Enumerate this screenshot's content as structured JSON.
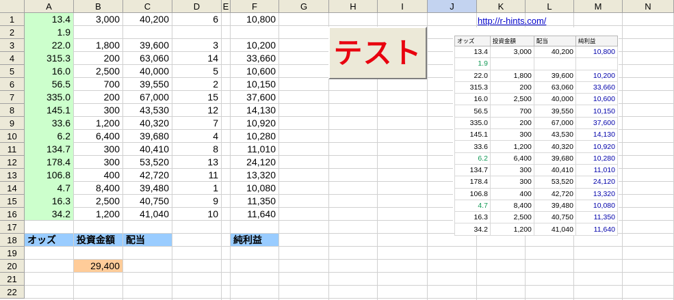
{
  "columns": [
    "A",
    "B",
    "C",
    "D",
    "E",
    "F",
    "G",
    "H",
    "I",
    "J",
    "K",
    "L",
    "M",
    "N"
  ],
  "selected_column": "J",
  "rows": [
    "1",
    "2",
    "3",
    "4",
    "5",
    "6",
    "7",
    "8",
    "9",
    "10",
    "11",
    "12",
    "13",
    "14",
    "15",
    "16",
    "17",
    "18",
    "19",
    "20",
    "21",
    "22"
  ],
  "data_rows": [
    {
      "odds": "13.4",
      "bet": "3,000",
      "payout": "40,200",
      "count": "6",
      "profit": "10,800"
    },
    {
      "odds": "1.9",
      "bet": "",
      "payout": "",
      "count": "",
      "profit": ""
    },
    {
      "odds": "22.0",
      "bet": "1,800",
      "payout": "39,600",
      "count": "3",
      "profit": "10,200"
    },
    {
      "odds": "315.3",
      "bet": "200",
      "payout": "63,060",
      "count": "14",
      "profit": "33,660"
    },
    {
      "odds": "16.0",
      "bet": "2,500",
      "payout": "40,000",
      "count": "5",
      "profit": "10,600"
    },
    {
      "odds": "56.5",
      "bet": "700",
      "payout": "39,550",
      "count": "2",
      "profit": "10,150"
    },
    {
      "odds": "335.0",
      "bet": "200",
      "payout": "67,000",
      "count": "15",
      "profit": "37,600"
    },
    {
      "odds": "145.1",
      "bet": "300",
      "payout": "43,530",
      "count": "12",
      "profit": "14,130"
    },
    {
      "odds": "33.6",
      "bet": "1,200",
      "payout": "40,320",
      "count": "7",
      "profit": "10,920"
    },
    {
      "odds": "6.2",
      "bet": "6,400",
      "payout": "39,680",
      "count": "4",
      "profit": "10,280"
    },
    {
      "odds": "134.7",
      "bet": "300",
      "payout": "40,410",
      "count": "8",
      "profit": "11,010"
    },
    {
      "odds": "178.4",
      "bet": "300",
      "payout": "53,520",
      "count": "13",
      "profit": "24,120"
    },
    {
      "odds": "106.8",
      "bet": "400",
      "payout": "42,720",
      "count": "11",
      "profit": "13,320"
    },
    {
      "odds": "4.7",
      "bet": "8,400",
      "payout": "39,480",
      "count": "1",
      "profit": "10,080"
    },
    {
      "odds": "16.3",
      "bet": "2,500",
      "payout": "40,750",
      "count": "9",
      "profit": "11,350"
    },
    {
      "odds": "34.2",
      "bet": "1,200",
      "payout": "41,040",
      "count": "10",
      "profit": "11,640"
    }
  ],
  "labels": {
    "odds": "オッズ",
    "bet": "投資金額",
    "payout": "配当",
    "profit": "純利益"
  },
  "total_bet": "29,400",
  "button_label": "テスト",
  "link_text": "http://r-hints.com/",
  "mini_table": {
    "headers": [
      "オッズ",
      "投資金額",
      "配当",
      "純利益"
    ],
    "rows": [
      [
        "13.4",
        "3,000",
        "40,200",
        "10,800"
      ],
      [
        "1.9",
        "",
        "",
        ""
      ],
      [
        "22.0",
        "1,800",
        "39,600",
        "10,200"
      ],
      [
        "315.3",
        "200",
        "63,060",
        "33,660"
      ],
      [
        "16.0",
        "2,500",
        "40,000",
        "10,600"
      ],
      [
        "56.5",
        "700",
        "39,550",
        "10,150"
      ],
      [
        "335.0",
        "200",
        "67,000",
        "37,600"
      ],
      [
        "145.1",
        "300",
        "43,530",
        "14,130"
      ],
      [
        "33.6",
        "1,200",
        "40,320",
        "10,920"
      ],
      [
        "6.2",
        "6,400",
        "39,680",
        "10,280"
      ],
      [
        "134.7",
        "300",
        "40,410",
        "11,010"
      ],
      [
        "178.4",
        "300",
        "53,520",
        "24,120"
      ],
      [
        "106.8",
        "400",
        "42,720",
        "13,320"
      ],
      [
        "4.7",
        "8,400",
        "39,480",
        "10,080"
      ],
      [
        "16.3",
        "2,500",
        "40,750",
        "11,350"
      ],
      [
        "34.2",
        "1,200",
        "41,040",
        "11,640"
      ]
    ],
    "green_rows": [
      1,
      9,
      13
    ]
  },
  "colors": {
    "odds_fill": "#ccffcc",
    "label_fill": "#99ccff",
    "total_fill": "#ffcc99",
    "button_text": "#e8000f",
    "profit_text": "#0000aa",
    "odds_text_green": "#119955"
  }
}
